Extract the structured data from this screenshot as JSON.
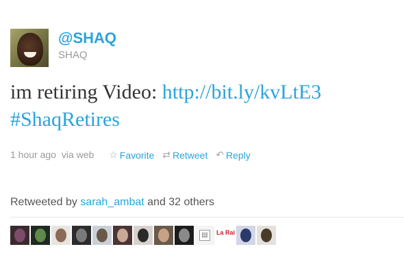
{
  "user": {
    "screen_name": "@SHAQ",
    "real_name": "SHAQ"
  },
  "tweet": {
    "text_before": "im retiring Video: ",
    "link": "http://bit.ly/kvLtE3",
    "hashtag": "#ShaqRetires"
  },
  "meta": {
    "time": "1 hour ago",
    "via": "via web",
    "favorite_label": "Favorite",
    "retweet_label": "Retweet",
    "reply_label": "Reply"
  },
  "retweeted": {
    "prefix": "Retweeted by",
    "user": "sarah_ambat",
    "suffix": "and 32 others"
  },
  "retweeter_avatars": [
    {
      "bg": "#3a2a2e",
      "fg": "#7d4c6a"
    },
    {
      "bg": "#1f2a22",
      "fg": "#5e8a4c"
    },
    {
      "bg": "#e8e4e0",
      "fg": "#8c6a58"
    },
    {
      "bg": "#2c2c2c",
      "fg": "#7a7a7a"
    },
    {
      "bg": "#c9d0d8",
      "fg": "#6a5848"
    },
    {
      "bg": "#4a3434",
      "fg": "#c9a898"
    },
    {
      "bg": "#d7d2ce",
      "fg": "#2a2a2a"
    },
    {
      "bg": "#6a5a4a",
      "fg": "#c7a285"
    },
    {
      "bg": "#1c1c1c",
      "fg": "#8a8a8a"
    },
    {
      "bg": "#f4f4f4",
      "fg": "default"
    },
    {
      "bg": "#ffffff",
      "fg": "logo",
      "text": "La Raider"
    },
    {
      "bg": "#d2d6e6",
      "fg": "#2a3a6a"
    },
    {
      "bg": "#e4e0dc",
      "fg": "#4a3a2a"
    }
  ]
}
